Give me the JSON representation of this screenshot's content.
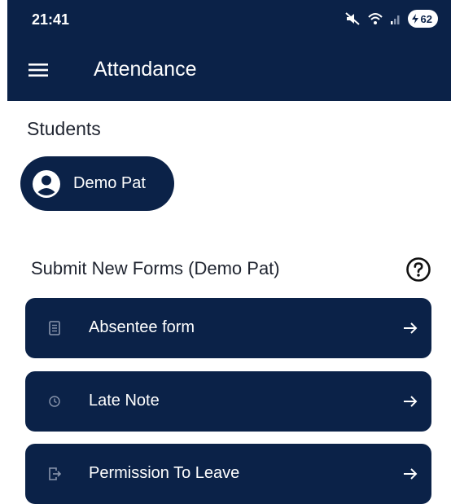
{
  "status_bar": {
    "time": "21:41",
    "battery_level": "62",
    "icons": [
      "mute-icon",
      "wifi-icon",
      "signal-icon",
      "battery-icon"
    ]
  },
  "app_bar": {
    "menu_icon": "hamburger-menu-icon",
    "title": "Attendance"
  },
  "students": {
    "label": "Students",
    "items": [
      {
        "name": "Demo Pat",
        "icon": "account-circle-icon"
      }
    ]
  },
  "forms": {
    "title": "Submit New Forms (Demo Pat)",
    "help_icon": "help-circle-icon",
    "items": [
      {
        "label": "Absentee form",
        "icon": "document-icon",
        "arrow": "arrow-right-icon"
      },
      {
        "label": "Late Note",
        "icon": "clock-icon",
        "arrow": "arrow-right-icon"
      },
      {
        "label": "Permission To Leave",
        "icon": "exit-door-icon",
        "arrow": "arrow-right-icon"
      }
    ]
  },
  "colors": {
    "primary": "#0b2248",
    "on_primary": "#ffffff",
    "text": "#1f2430",
    "background": "#ffffff"
  }
}
